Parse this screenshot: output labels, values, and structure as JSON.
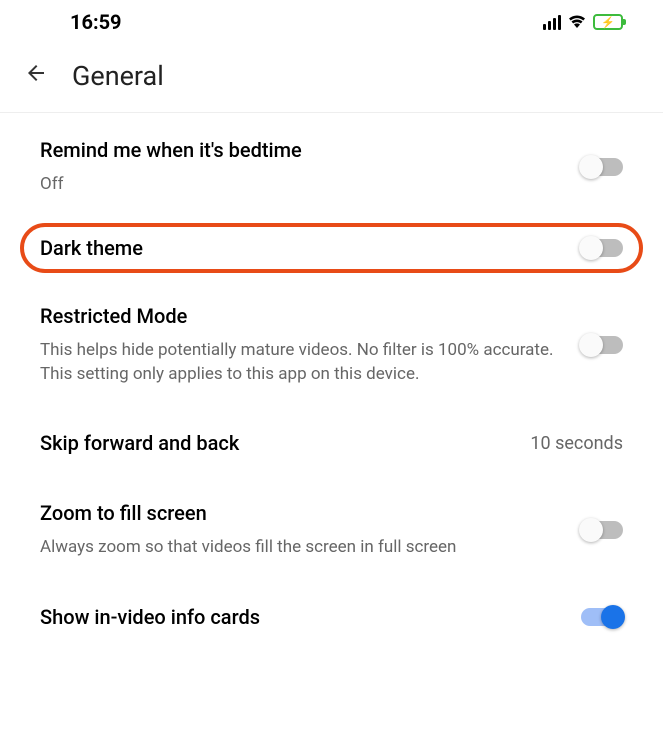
{
  "status": {
    "time": "16:59"
  },
  "header": {
    "title": "General"
  },
  "settings": {
    "bedtime": {
      "title": "Remind me when it's bedtime",
      "subtitle": "Off",
      "toggle": "off"
    },
    "darkTheme": {
      "title": "Dark theme",
      "toggle": "off",
      "highlighted": true
    },
    "restrictedMode": {
      "title": "Restricted Mode",
      "subtitle": "This helps hide potentially mature videos. No filter is 100% accurate. This setting only applies to this app on this device.",
      "toggle": "off"
    },
    "skip": {
      "title": "Skip forward and back",
      "value": "10 seconds"
    },
    "zoom": {
      "title": "Zoom to fill screen",
      "subtitle": "Always zoom so that videos fill the screen in full screen",
      "toggle": "off"
    },
    "infoCards": {
      "title": "Show in-video info cards",
      "toggle": "on"
    }
  }
}
